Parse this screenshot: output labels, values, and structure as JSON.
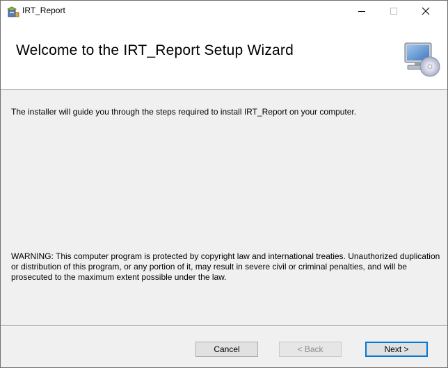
{
  "window": {
    "title": "IRT_Report",
    "icon": "installer-icon",
    "controls": [
      "minimize-icon",
      "maximize-icon",
      "close-icon"
    ]
  },
  "header": {
    "title": "Welcome to the IRT_Report Setup Wizard",
    "icon": "computer-cd-icon"
  },
  "body": {
    "intro": "The installer will guide you through the steps required to install IRT_Report on your computer.",
    "warning": "WARNING: This computer program is protected by copyright law and international treaties. Unauthorized duplication or distribution of this program, or any portion of it, may result in severe civil or criminal penalties, and will be prosecuted to the maximum extent possible under the law."
  },
  "buttons": {
    "cancel": "Cancel",
    "back": "< Back",
    "next": "Next >"
  },
  "colors": {
    "accent": "#0078d7",
    "header_bg": "#ffffff",
    "body_bg": "#f0f0f0"
  }
}
